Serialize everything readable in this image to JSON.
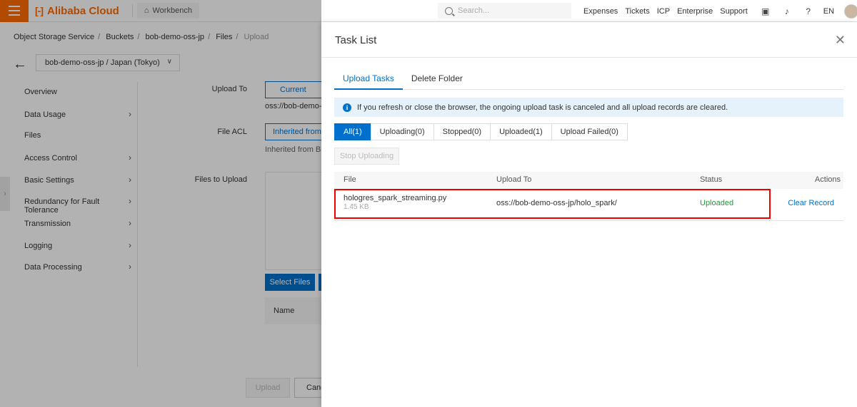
{
  "topbar": {
    "logo_text": "Alibaba Cloud",
    "logo_mark": "[-]",
    "workbench_label": "Workbench",
    "search_placeholder": "Search...",
    "nav": [
      "Expenses",
      "Tickets",
      "ICP",
      "Enterprise",
      "Support"
    ],
    "lang": "EN"
  },
  "breadcrumb": [
    "Object Storage Service",
    "Buckets",
    "bob-demo-oss-jp",
    "Files",
    "Upload"
  ],
  "bucket_selector": "bob-demo-oss-jp / Japan (Tokyo)",
  "sidebar": {
    "items": [
      {
        "label": "Overview",
        "has_arrow": false
      },
      {
        "label": "Data Usage",
        "has_arrow": true
      },
      {
        "label": "Files",
        "has_arrow": false
      },
      {
        "label": "Access Control",
        "has_arrow": true
      },
      {
        "label": "Basic Settings",
        "has_arrow": true
      },
      {
        "label": "Redundancy for Fault Tolerance",
        "has_arrow": true
      },
      {
        "label": "Transmission",
        "has_arrow": true
      },
      {
        "label": "Logging",
        "has_arrow": true
      },
      {
        "label": "Data Processing",
        "has_arrow": true
      }
    ]
  },
  "upload_form": {
    "upload_to_label": "Upload To",
    "upload_to_option": "Current",
    "upload_path": "oss://bob-demo-",
    "file_acl_label": "File ACL",
    "file_acl_option": "Inherited from",
    "file_acl_hint": "Inherited from Bu",
    "files_to_upload_label": "Files to Upload",
    "select_files": "Select Files",
    "name_column": "Name",
    "upload_button": "Upload",
    "cancel_button": "Canc"
  },
  "drawer": {
    "title": "Task List",
    "tabs": [
      "Upload Tasks",
      "Delete Folder"
    ],
    "notice": "If you refresh or close the browser, the ongoing upload task is canceled and all upload records are cleared.",
    "filters": [
      "All(1)",
      "Uploading(0)",
      "Stopped(0)",
      "Uploaded(1)",
      "Upload Failed(0)"
    ],
    "stop_button": "Stop Uploading",
    "table": {
      "headers": [
        "File",
        "Upload To",
        "Status",
        "Actions"
      ],
      "rows": [
        {
          "file": "hologres_spark_streaming.py",
          "size": "1.45 KB",
          "upload_to": "oss://bob-demo-oss-jp/holo_spark/",
          "status": "Uploaded",
          "action": "Clear Record"
        }
      ]
    }
  },
  "colors": {
    "brand": "#ff6a00",
    "primary": "#0070cc",
    "success": "#1e9e36",
    "highlight": "#e00000"
  }
}
